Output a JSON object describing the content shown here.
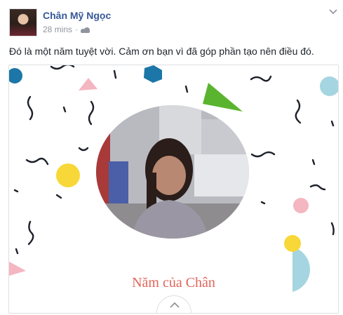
{
  "post": {
    "author": "Chân Mỹ Ngọc",
    "time": "28 mins",
    "separator": "·",
    "privacy_icon": "friends-icon",
    "status_text": "Đó là một năm tuyệt vời. Cảm ơn bạn vì đã góp phần tạo nên điều đó.",
    "options_icon": "chevron-down-icon"
  },
  "card": {
    "title": "Năm của Chân",
    "expand_icon": "chevron-up-icon"
  },
  "colors": {
    "author_link": "#365899",
    "meta_text": "#90949c",
    "card_title": "#e1655a",
    "confetti_blue": "#1c76a8",
    "confetti_yellow": "#f8d838",
    "confetti_green": "#5ab42f",
    "confetti_pink": "#f4b6c0",
    "confetti_light_blue": "#a5d5e0"
  }
}
